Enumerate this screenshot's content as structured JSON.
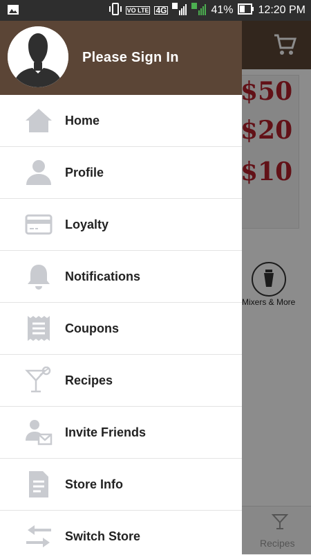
{
  "status_bar": {
    "volte": "VO LTE",
    "network": "4G",
    "sim1": "1",
    "sim2": "2",
    "battery": "41%",
    "time": "12:20 PM"
  },
  "drawer": {
    "header_title": "Please Sign In",
    "items": [
      {
        "label": "Home",
        "icon": "home-icon"
      },
      {
        "label": "Profile",
        "icon": "profile-icon"
      },
      {
        "label": "Loyalty",
        "icon": "card-icon"
      },
      {
        "label": "Notifications",
        "icon": "bell-icon"
      },
      {
        "label": "Coupons",
        "icon": "coupon-icon"
      },
      {
        "label": "Recipes",
        "icon": "cocktail-icon"
      },
      {
        "label": "Invite Friends",
        "icon": "invite-icon"
      },
      {
        "label": "Store Info",
        "icon": "document-icon"
      },
      {
        "label": "Switch Store",
        "icon": "swap-icon"
      }
    ]
  },
  "background": {
    "promo_prices": [
      "$50",
      "$20",
      "$10"
    ],
    "mixers_label": "Mixers & More",
    "bottom_nav_recipes": "Recipes"
  },
  "colors": {
    "header_brown": "#5b4536",
    "icon_gray": "#c9cbd0",
    "price_red": "#b3202a"
  }
}
